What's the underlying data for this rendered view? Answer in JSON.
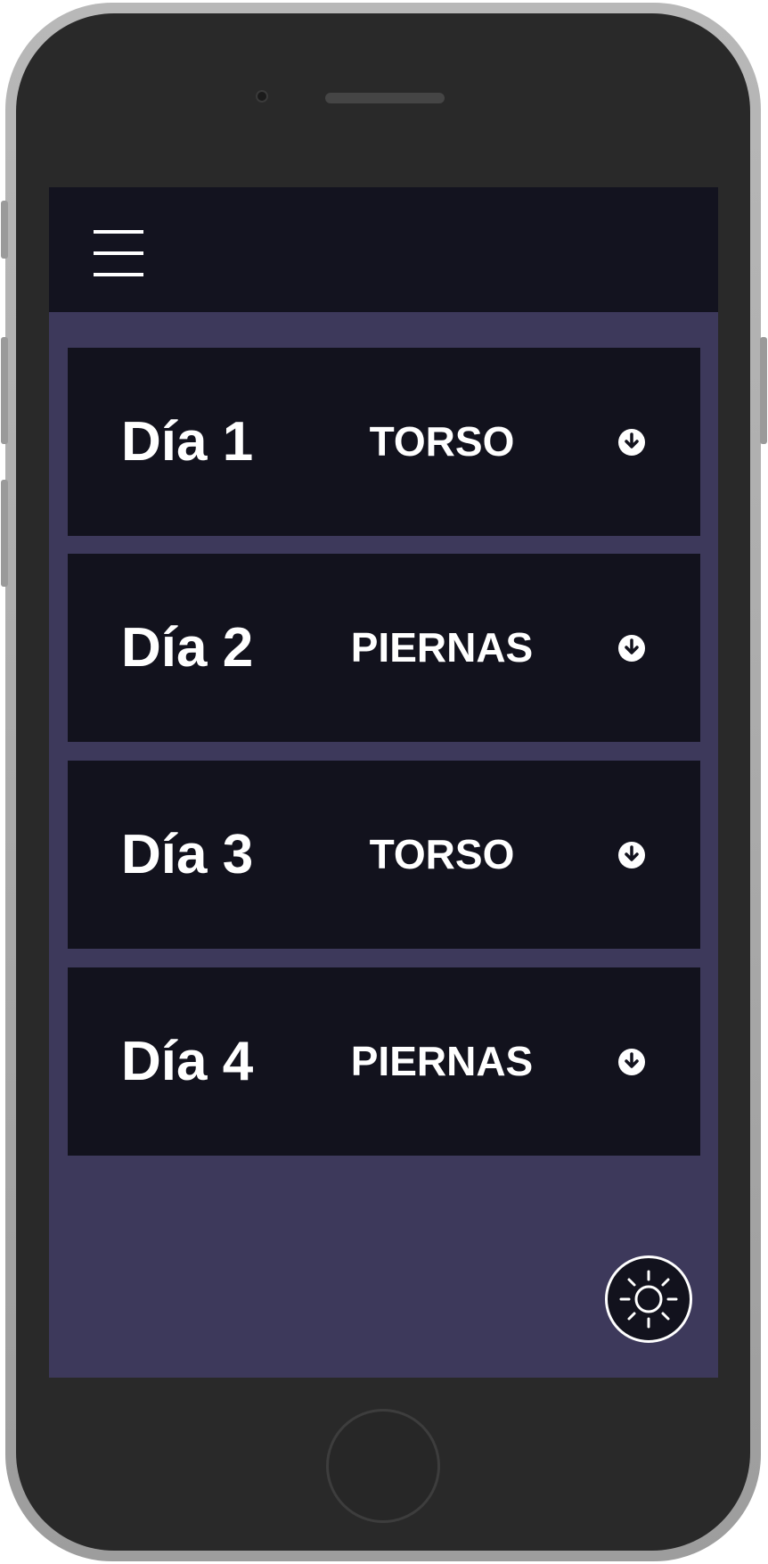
{
  "app": {
    "menu_icon": "hamburger-menu-icon",
    "theme_icon": "sun-icon",
    "expand_icon": "arrow-down-circle-icon",
    "colors": {
      "background": "#3d395b",
      "topbar": "#13131f",
      "card": "#12121d",
      "text": "#ffffff"
    }
  },
  "days": [
    {
      "label": "Día 1",
      "type": "TORSO"
    },
    {
      "label": "Día 2",
      "type": "PIERNAS"
    },
    {
      "label": "Día 3",
      "type": "TORSO"
    },
    {
      "label": "Día 4",
      "type": "PIERNAS"
    }
  ]
}
